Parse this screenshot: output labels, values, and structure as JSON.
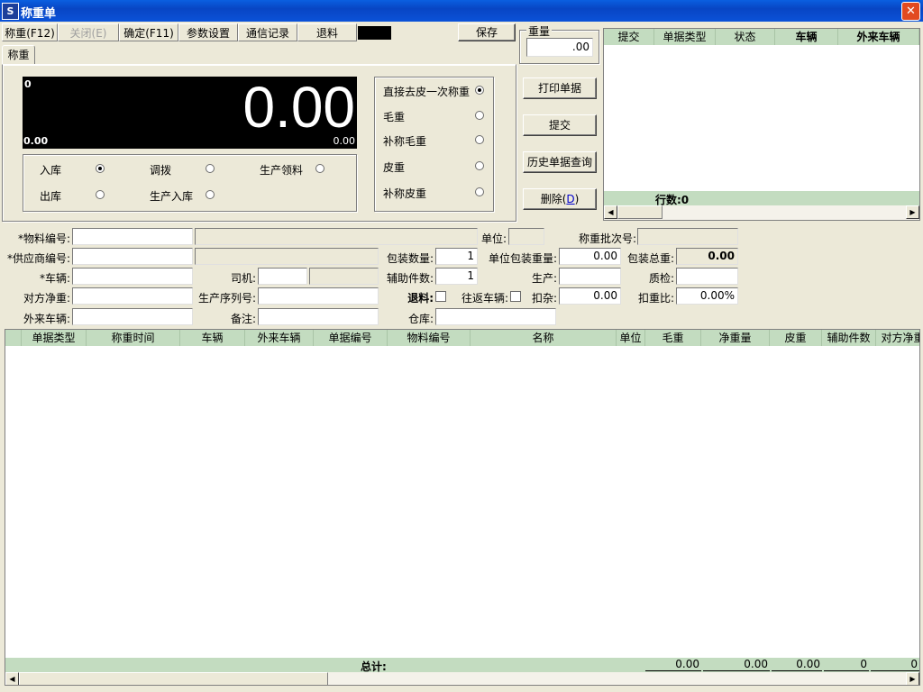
{
  "window": {
    "title": "称重单",
    "app_icon": "S",
    "close_glyph": "✕"
  },
  "toolbar": {
    "weigh": "称重(F12)",
    "close": "关闭(E)",
    "confirm": "确定(F11)",
    "params": "参数设置",
    "comm_log": "通信记录",
    "return_material": "退料",
    "save": "保存"
  },
  "tab": {
    "label": "称重"
  },
  "weight_box": {
    "label": "重量",
    "value": ".00"
  },
  "display": {
    "big_value": "0.00",
    "top_left": "0",
    "bottom_left": "0.00",
    "bottom_right": "0.00"
  },
  "mode_options": [
    {
      "label": "直接去皮一次称重",
      "selected": true
    },
    {
      "label": "毛重",
      "selected": false
    },
    {
      "label": "补称毛重",
      "selected": false
    },
    {
      "label": "皮重",
      "selected": false
    },
    {
      "label": "补称皮重",
      "selected": false
    }
  ],
  "type_options": [
    {
      "label": "入库",
      "selected": true
    },
    {
      "label": "调拨",
      "selected": false
    },
    {
      "label": "生产领料",
      "selected": false
    },
    {
      "label": "出库",
      "selected": false
    },
    {
      "label": "生产入库",
      "selected": false
    }
  ],
  "actions": {
    "print": "打印单据",
    "submit": "提交",
    "history": "历史单据查询",
    "delete": "删除(",
    "delete_key": "D",
    "delete_end": ")"
  },
  "top_grid": {
    "columns": [
      "提交",
      "单据类型",
      "状态",
      "车辆",
      "外来车辆"
    ],
    "row_count_label": "行数:0"
  },
  "form": {
    "material_code_label": "*物料编号:",
    "unit_label": "单位:",
    "weigh_batch_label": "称重批次号:",
    "supplier_code_label": "*供应商编号:",
    "pack_qty_label": "包装数量:",
    "pack_qty_value": "1",
    "unit_pack_weight_label": "单位包装重量:",
    "unit_pack_weight_value": "0.00",
    "pack_total_label": "包装总重:",
    "pack_total_value": "0.00",
    "vehicle_label": "*车辆:",
    "driver_label": "司机:",
    "aux_qty_label": "辅助件数:",
    "aux_qty_value": "1",
    "production_label": "生产:",
    "qc_label": "质检:",
    "counter_net_label": "对方净重:",
    "serial_label": "生产序列号:",
    "return_label": "退料:",
    "round_trip_label": "往返车辆:",
    "deduct_label": "扣杂:",
    "deduct_value": "0.00",
    "deduct_ratio_label": "扣重比:",
    "deduct_ratio_value": "0.00%",
    "external_vehicle_label": "外来车辆:",
    "remark_label": "备注:",
    "warehouse_label": "仓库:"
  },
  "main_grid": {
    "columns": [
      "单据类型",
      "称重时间",
      "车辆",
      "外来车辆",
      "单据编号",
      "物料编号",
      "名称",
      "单位",
      "毛重",
      "净重量",
      "皮重",
      "辅助件数",
      "对方净重"
    ],
    "total_label": "总计:",
    "totals": [
      "0.00",
      "0.00",
      "0.00",
      "0",
      "0"
    ]
  },
  "colors": {
    "titlebar": "#0845c4",
    "grid_header": "#c3dcc0",
    "display_bg": "#000000",
    "face": "#ece9d8"
  }
}
